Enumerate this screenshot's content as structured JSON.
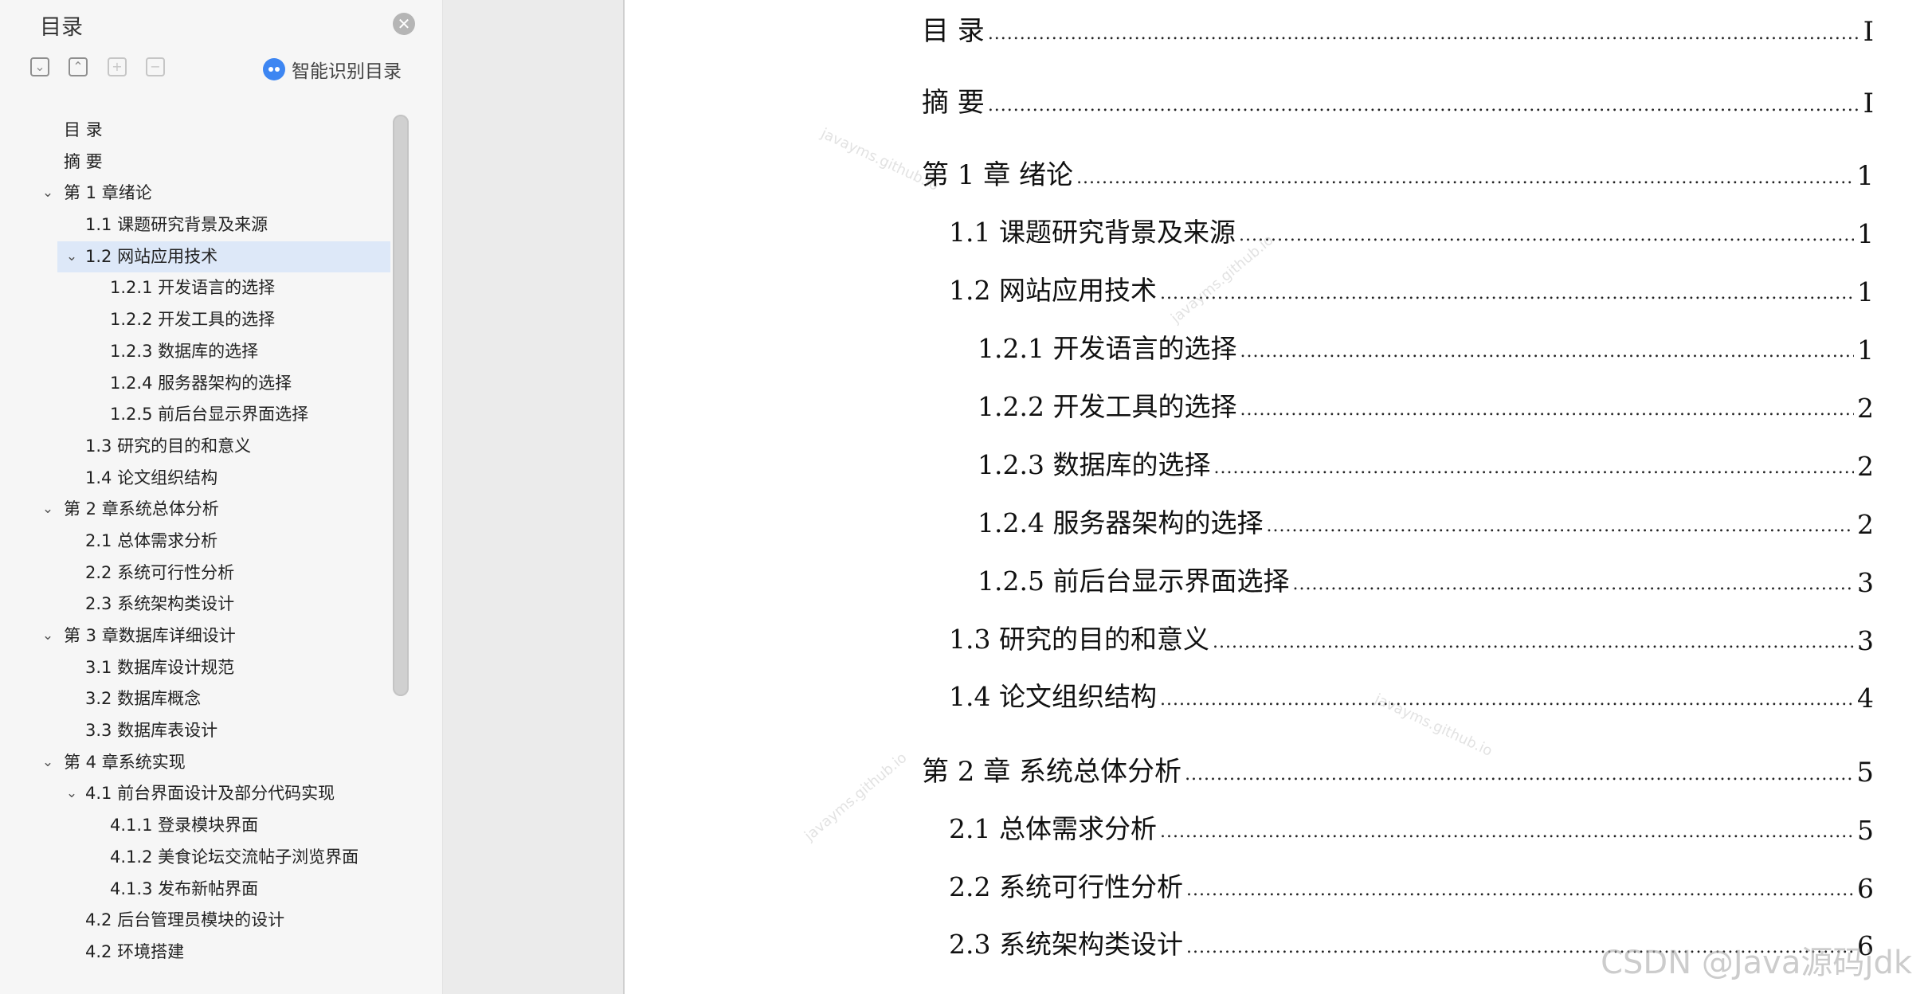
{
  "toc_panel": {
    "title": "目录",
    "smart_toc_label": "智能识别目录",
    "tool_expand": "⌄",
    "tool_collapse": "⌃",
    "tool_plus": "+",
    "tool_minus": "−",
    "close_glyph": "✕",
    "items": [
      {
        "label": "目  录",
        "level": 0,
        "chevron": ""
      },
      {
        "label": "摘  要",
        "level": 0,
        "chevron": ""
      },
      {
        "label": "第 1 章绪论",
        "level": 0,
        "chevron": "⌄"
      },
      {
        "label": "1.1  课题研究背景及来源",
        "level": 1,
        "chevron": ""
      },
      {
        "label": "1.2  网站应用技术",
        "level": 1,
        "chevron": "⌄",
        "active": true
      },
      {
        "label": "1.2.1  开发语言的选择",
        "level": 2,
        "chevron": ""
      },
      {
        "label": "1.2.2  开发工具的选择",
        "level": 2,
        "chevron": ""
      },
      {
        "label": "1.2.3  数据库的选择",
        "level": 2,
        "chevron": ""
      },
      {
        "label": "1.2.4  服务器架构的选择",
        "level": 2,
        "chevron": ""
      },
      {
        "label": "1.2.5  前后台显示界面选择",
        "level": 2,
        "chevron": ""
      },
      {
        "label": "1.3  研究的目的和意义",
        "level": 1,
        "chevron": ""
      },
      {
        "label": "1.4  论文组织结构",
        "level": 1,
        "chevron": ""
      },
      {
        "label": "第 2 章系统总体分析",
        "level": 0,
        "chevron": "⌄"
      },
      {
        "label": "2.1  总体需求分析",
        "level": 1,
        "chevron": ""
      },
      {
        "label": "2.2  系统可行性分析",
        "level": 1,
        "chevron": ""
      },
      {
        "label": "2.3  系统架构类设计",
        "level": 1,
        "chevron": ""
      },
      {
        "label": "第 3 章数据库详细设计",
        "level": 0,
        "chevron": "⌄"
      },
      {
        "label": "3.1  数据库设计规范",
        "level": 1,
        "chevron": ""
      },
      {
        "label": "3.2  数据库概念",
        "level": 1,
        "chevron": ""
      },
      {
        "label": "3.3  数据库表设计",
        "level": 1,
        "chevron": ""
      },
      {
        "label": "第 4 章系统实现",
        "level": 0,
        "chevron": "⌄"
      },
      {
        "label": "4.1  前台界面设计及部分代码实现",
        "level": 1,
        "chevron": "⌄"
      },
      {
        "label": "4.1.1  登录模块界面",
        "level": 2,
        "chevron": ""
      },
      {
        "label": "4.1.2  美食论坛交流帖子浏览界面",
        "level": 2,
        "chevron": ""
      },
      {
        "label": "4.1.3  发布新帖界面",
        "level": 2,
        "chevron": ""
      },
      {
        "label": "4.2  后台管理员模块的设计",
        "level": 1,
        "chevron": ""
      },
      {
        "label": "4.2  环境搭建",
        "level": 1,
        "chevron": ""
      }
    ]
  },
  "document": {
    "entries": [
      {
        "title": "目  录",
        "page": "I"
      },
      {
        "title": "摘  要",
        "page": "I"
      },
      {
        "title": "第 1 章  绪论",
        "page": "1"
      },
      {
        "title": "1.1  课题研究背景及来源",
        "page": "1"
      },
      {
        "title": "1.2  网站应用技术",
        "page": "1"
      },
      {
        "title": "1.2.1  开发语言的选择",
        "page": "1"
      },
      {
        "title": "1.2.2  开发工具的选择",
        "page": "2"
      },
      {
        "title": "1.2.3  数据库的选择",
        "page": "2"
      },
      {
        "title": "1.2.4  服务器架构的选择",
        "page": "2"
      },
      {
        "title": "1.2.5  前后台显示界面选择",
        "page": "3"
      },
      {
        "title": "1.3  研究的目的和意义",
        "page": "3"
      },
      {
        "title": "1.4  论文组织结构",
        "page": "4"
      },
      {
        "title": "第 2 章  系统总体分析",
        "page": "5"
      },
      {
        "title": "2.1  总体需求分析",
        "page": "5"
      },
      {
        "title": "2.2  系统可行性分析",
        "page": "6"
      },
      {
        "title": "2.3  系统架构类设计",
        "page": "6"
      }
    ],
    "watermark_text": "javayms.github.io",
    "csdn_watermark": "CSDN @Java源码jdk"
  },
  "colors": {
    "panel_bg": "#f6f6f6",
    "active_item_bg": "#dde8f8",
    "accent_blue": "#3d86f2",
    "doc_bg": "#ebebeb"
  }
}
